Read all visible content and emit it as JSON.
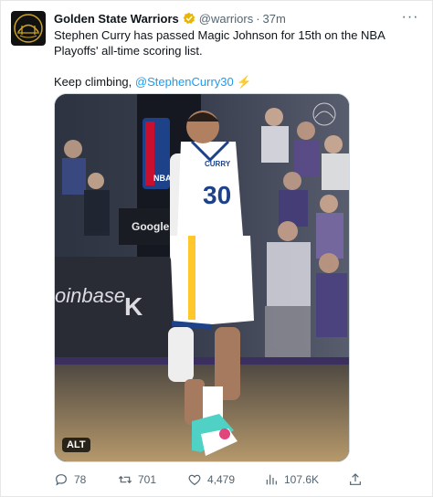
{
  "tweet": {
    "author_name": "Golden State Warriors",
    "author_handle": "@warriors",
    "separator": "·",
    "time": "37m",
    "more_label": "···",
    "text_line1": "Stephen Curry has passed Magic Johnson for 15th on the NBA Playoffs' all-time scoring list.",
    "text_line2_prefix": "Keep climbing, ",
    "text_line2_mention": "@StephenCurry30",
    "text_line2_emoji": "⚡",
    "media": {
      "alt_badge": "ALT",
      "jersey_name": "CURRY",
      "jersey_number": "30",
      "signage_google": "Google P",
      "signage_coinbase": "oinbase",
      "signage_kia": "K",
      "signage_nba": "NBA"
    },
    "actions": {
      "replies": "78",
      "retweets": "701",
      "likes": "4,479",
      "views": "107.6K"
    }
  },
  "colors": {
    "link": "#1d9bf0",
    "verified": "#e8b600",
    "secondary_text": "#536471",
    "warriors_blue": "#1d428a",
    "warriors_gold": "#ffc72c"
  },
  "icons": {
    "avatar": "warriors-bridge-logo",
    "verified": "gold-verified-badge-icon",
    "more": "more-options-icon",
    "reply": "reply-icon",
    "retweet": "retweet-icon",
    "like": "heart-icon",
    "views": "views-icon",
    "share": "share-icon"
  }
}
